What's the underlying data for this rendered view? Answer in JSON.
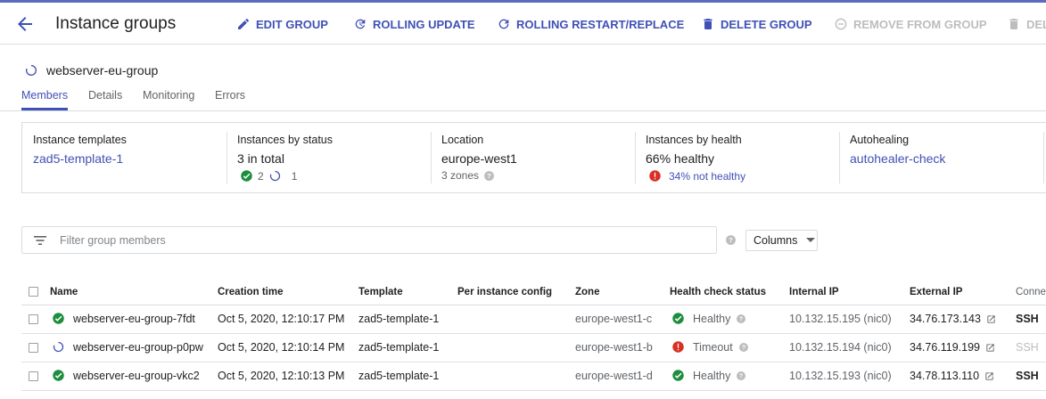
{
  "header": {
    "title": "Instance groups",
    "actions": {
      "edit": "EDIT GROUP",
      "rolling_update": "ROLLING UPDATE",
      "rolling_restart": "ROLLING RESTART/REPLACE",
      "delete": "DELETE GROUP",
      "remove": "REMOVE FROM GROUP",
      "delete_instance": "DEL"
    }
  },
  "group": {
    "name": "webserver-eu-group"
  },
  "tabs": [
    "Members",
    "Details",
    "Monitoring",
    "Errors"
  ],
  "summary": {
    "templates": {
      "label": "Instance templates",
      "value": "zad5-template-1"
    },
    "status": {
      "label": "Instances by status",
      "value": "3 in total",
      "ok_count": "2",
      "updating_count": "1"
    },
    "location": {
      "label": "Location",
      "value": "europe-west1",
      "zones": "3 zones"
    },
    "health": {
      "label": "Instances by health",
      "value": "66% healthy",
      "unhealthy": "34% not healthy"
    },
    "autohealing": {
      "label": "Autohealing",
      "value": "autohealer-check"
    }
  },
  "filter": {
    "placeholder": "Filter group members"
  },
  "columns_button": "Columns",
  "table": {
    "headers": [
      "Name",
      "Creation time",
      "Template",
      "Per instance config",
      "Zone",
      "Health check status",
      "Internal IP",
      "External IP",
      "Conne"
    ],
    "rows": [
      {
        "status": "ok",
        "name": "webserver-eu-group-7fdt",
        "created": "Oct 5, 2020, 12:10:17 PM",
        "template": "zad5-template-1",
        "config": "",
        "zone": "europe-west1-c",
        "health_status": "ok",
        "health": "Healthy",
        "internal_ip": "10.132.15.195 (nic0)",
        "external_ip": "34.76.173.143",
        "connect": "SSH",
        "connect_enabled": true
      },
      {
        "status": "updating",
        "name": "webserver-eu-group-p0pw",
        "created": "Oct 5, 2020, 12:10:14 PM",
        "template": "zad5-template-1",
        "config": "",
        "zone": "europe-west1-b",
        "health_status": "error",
        "health": "Timeout",
        "internal_ip": "10.132.15.194 (nic0)",
        "external_ip": "34.76.119.199",
        "connect": "SSH",
        "connect_enabled": false
      },
      {
        "status": "ok",
        "name": "webserver-eu-group-vkc2",
        "created": "Oct 5, 2020, 12:10:13 PM",
        "template": "zad5-template-1",
        "config": "",
        "zone": "europe-west1-d",
        "health_status": "ok",
        "health": "Healthy",
        "internal_ip": "10.132.15.193 (nic0)",
        "external_ip": "34.78.113.110",
        "connect": "SSH",
        "connect_enabled": true
      }
    ]
  },
  "colors": {
    "accent": "#3f51b5",
    "ok": "#1e8e3e",
    "error": "#d93025",
    "disabled": "#bdbdbd"
  }
}
